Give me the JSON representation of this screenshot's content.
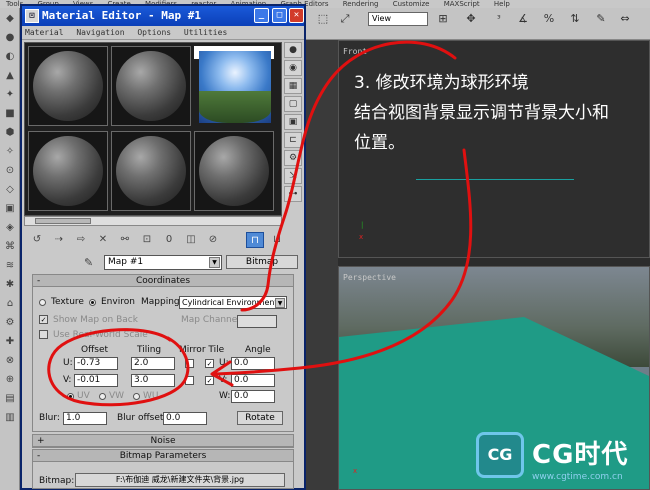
{
  "top_menu": [
    "Tools",
    "Group",
    "Views",
    "Create",
    "Modifiers",
    "reactor",
    "Animation",
    "Graph Editors",
    "Rendering",
    "Customize",
    "MAXScript",
    "Help"
  ],
  "main_toolbar": {
    "view_dropdown": "View"
  },
  "material_editor": {
    "title": "Material Editor - Map #1",
    "menu": [
      "Material",
      "Navigation",
      "Options",
      "Utilities"
    ],
    "map_name": "Map #1",
    "map_type_button": "Bitmap",
    "coordinates": {
      "header": "Coordinates",
      "texture_label": "Texture",
      "environ_label": "Environ",
      "environ_selected": true,
      "mapping_label": "Mapping:",
      "mapping_value": "Cylindrical Environment",
      "show_map_on_back": "Show Map on Back",
      "map_channel_label": "Map Channel:",
      "use_real_world_scale": "Use Real-World Scale",
      "offset_label": "Offset",
      "tiling_label": "Tiling",
      "mirror_tile_label": "Mirror Tile",
      "angle_label": "Angle",
      "u_label": "U:",
      "v_label": "V:",
      "w_label": "W:",
      "u_offset": "-0.73",
      "v_offset": "-0.01",
      "u_tiling": "2.0",
      "v_tiling": "3.0",
      "u_angle": "0.0",
      "v_angle": "0.0",
      "w_angle": "0.0",
      "uv_label": "UV",
      "vw_label": "VW",
      "wu_label": "WU",
      "blur_label": "Blur:",
      "blur_value": "1.0",
      "blur_offset_label": "Blur offset:",
      "blur_offset_value": "0.0",
      "rotate_button": "Rotate"
    },
    "noise": {
      "header": "Noise",
      "sign": "+"
    },
    "bitmap_parameters": {
      "header": "Bitmap Parameters",
      "sign": "-",
      "bitmap_label": "Bitmap:",
      "bitmap_path": "F:\\布伽迪 威龙\\新建文件夹\\背景.jpg"
    },
    "coordinates_sign": "-"
  },
  "viewports": {
    "front_label": "Front",
    "perspective_label": "Perspective",
    "annotation_lines": [
      "3. 修改环境为球形环境",
      "结合视图背景显示调节背景大小和",
      "位置。"
    ]
  },
  "watermark": {
    "logo_mark": "CG",
    "logo_text": "CG时代",
    "url": "www.cgtime.com.cn"
  },
  "colors": {
    "title_blue": "#0b3fb8",
    "annotation_red": "#e01010",
    "teal_plane": "#1f9b86",
    "underline_teal": "#19a0a0"
  }
}
